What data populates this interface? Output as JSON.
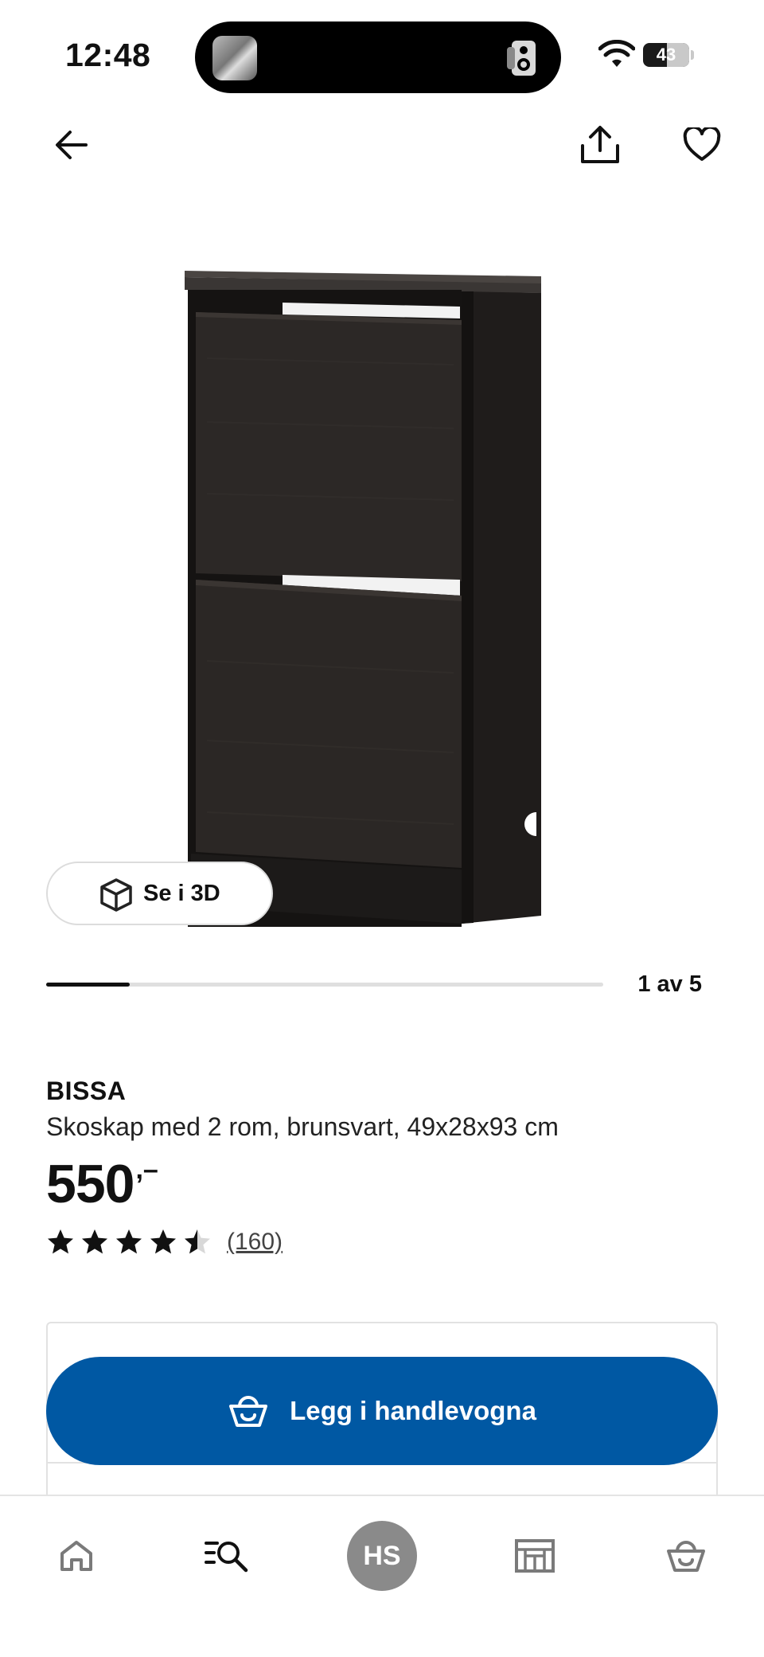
{
  "status_bar": {
    "time": "12:48",
    "battery": "43"
  },
  "top_nav": {
    "back_icon": "arrow-left-icon",
    "share_icon": "share-icon",
    "favorite_icon": "heart-icon"
  },
  "gallery": {
    "view3d_label": "Se i 3D",
    "position_text": "1 av 5",
    "current_index": 1,
    "total": 5
  },
  "product": {
    "name": "BISSA",
    "description": "Skoskap med 2 rom, brunsvart, 49x28x93 cm",
    "price": "550",
    "price_suffix": ",–",
    "rating": 4.5,
    "rating_max": 5,
    "review_count": "(160)"
  },
  "buy": {
    "add_to_cart_label": "Legg i handlevogna",
    "button_color": "#0058a3"
  },
  "tab_bar": {
    "home_icon": "home-icon",
    "search_icon": "search-list-icon",
    "profile_initials": "HS",
    "stores_icon": "store-icon",
    "cart_icon": "basket-icon"
  }
}
